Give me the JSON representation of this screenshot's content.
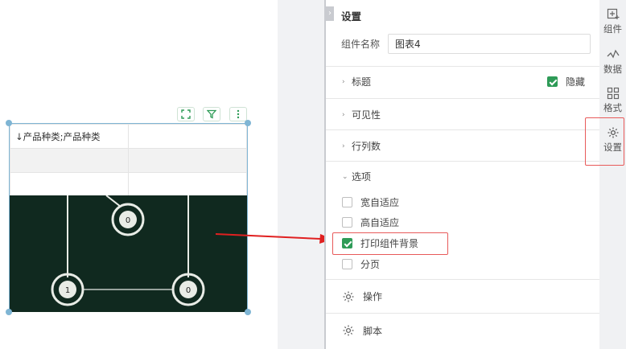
{
  "widget": {
    "table_header": "↓产品种类;产品种类",
    "picture_labels": [
      "0",
      "1",
      "0"
    ]
  },
  "panel": {
    "title": "设置",
    "name_label": "组件名称",
    "name_value": "图表4",
    "sections": {
      "title": "标题",
      "hide_label": "隐藏",
      "hide_checked": true,
      "visibility": "可见性",
      "rows_cols": "行列数",
      "options": "选项",
      "operation": "操作",
      "script": "脚本"
    },
    "options": [
      {
        "label": "宽自适应",
        "checked": false
      },
      {
        "label": "高自适应",
        "checked": false
      },
      {
        "label": "打印组件背景",
        "checked": true
      },
      {
        "label": "分页",
        "checked": false
      }
    ]
  },
  "strip": {
    "items": [
      {
        "label": "组件",
        "icon": "add-component-icon"
      },
      {
        "label": "数据",
        "icon": "data-icon"
      },
      {
        "label": "格式",
        "icon": "format-icon"
      },
      {
        "label": "设置",
        "icon": "gear-icon"
      }
    ]
  },
  "colors": {
    "accent": "#2e9b57",
    "highlight": "#e85a5a",
    "selection": "#7fb5d4"
  }
}
